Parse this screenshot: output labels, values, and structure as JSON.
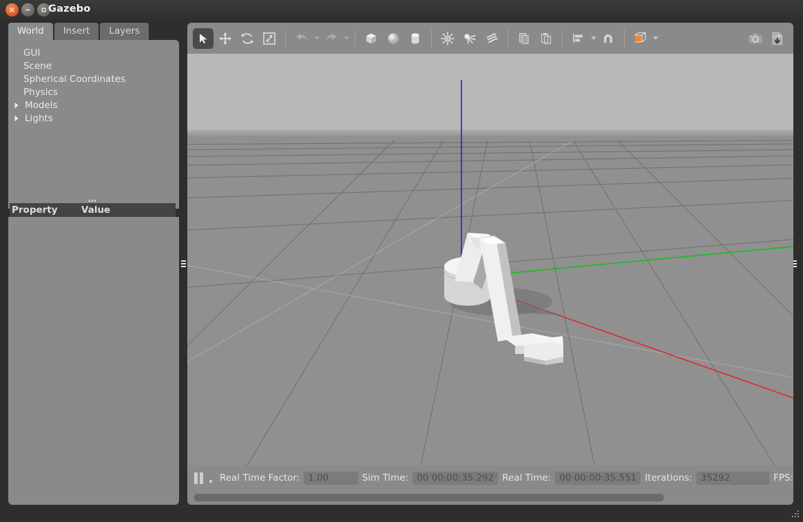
{
  "window": {
    "title": "Gazebo",
    "controls": [
      {
        "name": "close",
        "glyph": "×"
      },
      {
        "name": "minimize",
        "glyph": "−"
      },
      {
        "name": "maximize",
        "glyph": "□"
      }
    ]
  },
  "left_panel": {
    "tabs": [
      {
        "label": "World",
        "active": true
      },
      {
        "label": "Insert",
        "active": false
      },
      {
        "label": "Layers",
        "active": false
      }
    ],
    "tree": [
      {
        "label": "GUI",
        "expandable": false
      },
      {
        "label": "Scene",
        "expandable": false
      },
      {
        "label": "Spherical Coordinates",
        "expandable": false
      },
      {
        "label": "Physics",
        "expandable": false
      },
      {
        "label": "Models",
        "expandable": true
      },
      {
        "label": "Lights",
        "expandable": true
      }
    ],
    "property_table": {
      "columns": [
        "Property",
        "Value"
      ],
      "rows": []
    }
  },
  "toolbar": {
    "items": [
      {
        "name": "select-tool-icon",
        "label": "Select",
        "active": true
      },
      {
        "name": "translate-tool-icon",
        "label": "Translate",
        "active": false
      },
      {
        "name": "rotate-tool-icon",
        "label": "Rotate",
        "active": false
      },
      {
        "name": "scale-tool-icon",
        "label": "Scale",
        "active": false
      },
      {
        "name": "undo-icon",
        "label": "Undo",
        "active": false
      },
      {
        "name": "redo-icon",
        "label": "Redo",
        "active": false
      },
      {
        "name": "box-icon",
        "label": "Box",
        "active": false
      },
      {
        "name": "sphere-icon",
        "label": "Sphere",
        "active": false
      },
      {
        "name": "cylinder-icon",
        "label": "Cylinder",
        "active": false
      },
      {
        "name": "point-light-icon",
        "label": "Point Light",
        "active": false
      },
      {
        "name": "spot-light-icon",
        "label": "Spot Light",
        "active": false
      },
      {
        "name": "directional-light-icon",
        "label": "Directional Light",
        "active": false
      },
      {
        "name": "copy-icon",
        "label": "Copy",
        "active": false
      },
      {
        "name": "paste-icon",
        "label": "Paste",
        "active": false
      },
      {
        "name": "align-icon",
        "label": "Align",
        "active": false
      },
      {
        "name": "snap-icon",
        "label": "Snap",
        "active": false
      },
      {
        "name": "view-angle-icon",
        "label": "View Angle",
        "active": false
      },
      {
        "name": "screenshot-icon",
        "label": "Screenshot",
        "active": false
      },
      {
        "name": "log-record-icon",
        "label": "Log Data",
        "active": false
      }
    ]
  },
  "status_bar": {
    "playback": {
      "pause_label": "Pause",
      "step_label": "Step"
    },
    "fields": [
      {
        "label": "Real Time Factor:",
        "value": "1.00",
        "width": "w-rtf"
      },
      {
        "label": "Sim Time:",
        "value": "00 00:00:35.292",
        "width": "w-sim"
      },
      {
        "label": "Real Time:",
        "value": "00 00:00:35.551",
        "width": "w-real"
      },
      {
        "label": "Iterations:",
        "value": "35292",
        "width": "w-iter"
      }
    ],
    "fps_label": "FPS:"
  },
  "viewport": {
    "scene_name": "robot-arm-scene",
    "colors": {
      "sky": "#b9b9b9",
      "ground": "#909090",
      "grid_line": "#6f6f6f",
      "axis_x": "#e02a2a",
      "axis_y": "#1fb81f",
      "axis_z": "#2020dd",
      "model_light": "#f2f2f2",
      "model_mid": "#cfcfcf",
      "model_dark": "#8c8c8c"
    },
    "axes": [
      {
        "name": "z-axis-line",
        "color": "#2020dd"
      },
      {
        "name": "y-axis-line",
        "color": "#1fb81f"
      },
      {
        "name": "x-axis-line",
        "color": "#e02a2a"
      }
    ],
    "model": {
      "name": "robot-arm",
      "parts": [
        "base-cylinder",
        "upper-link",
        "lower-link",
        "gripper"
      ]
    }
  },
  "accent_color": "#dd5520"
}
